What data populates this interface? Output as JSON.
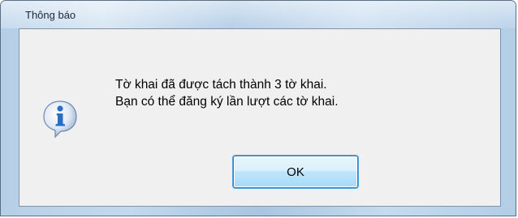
{
  "window": {
    "title": "Thông báo"
  },
  "dialog": {
    "icon": "information-icon",
    "message_line_1": "Tờ khai đã được tách thành 3 tờ khai.",
    "message_line_2": "Bạn có thể đăng ký lần lượt các tờ khai.",
    "ok_label": "OK"
  },
  "colors": {
    "frame": "#b7cfe6",
    "client_background": "#f0f0f0",
    "button_border": "#3c7fb1",
    "icon_blue": "#2a6fc4"
  }
}
